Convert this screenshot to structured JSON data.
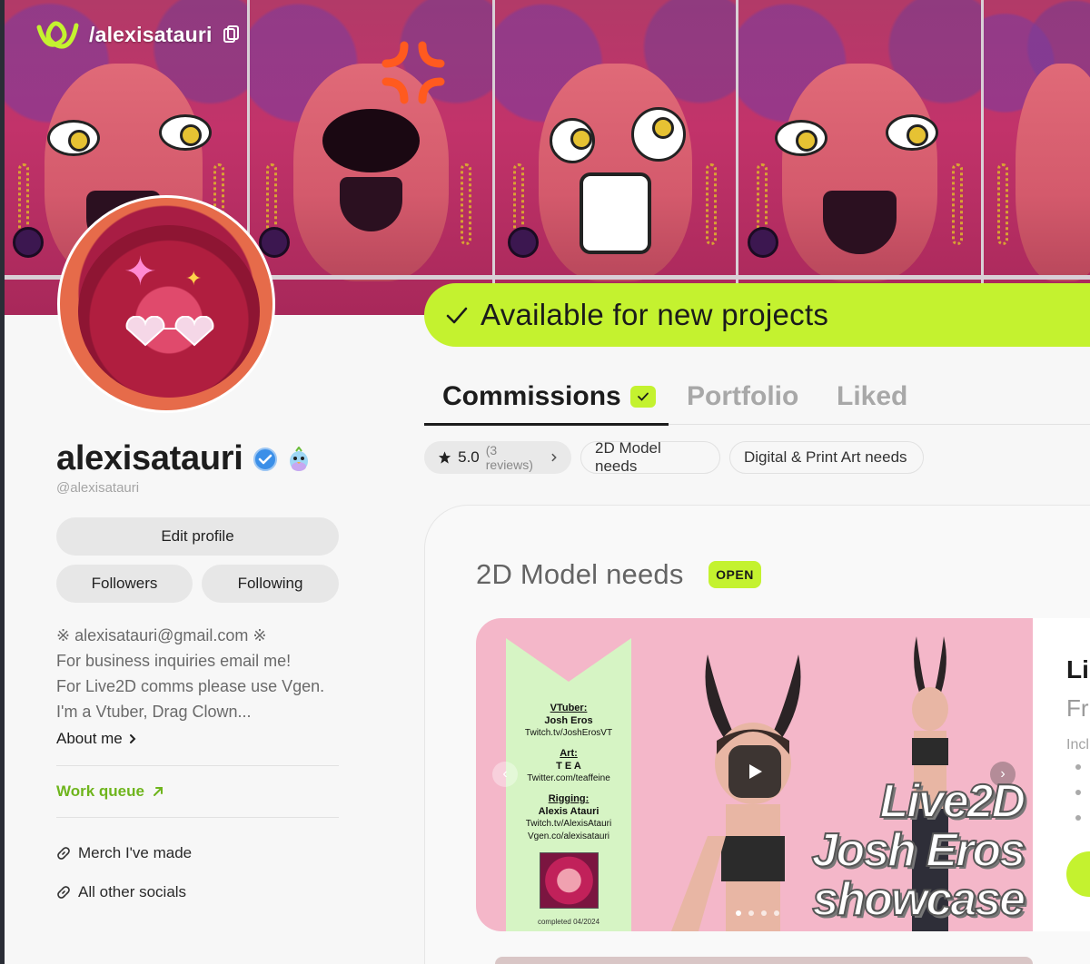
{
  "header": {
    "handle": "/alexisatauri"
  },
  "status": {
    "available": "Available for new projects"
  },
  "profile": {
    "display_name": "alexisatauri",
    "handle": "@alexisatauri",
    "edit_label": "Edit profile",
    "followers_label": "Followers",
    "following_label": "Following",
    "bio": [
      "※ alexisatauri@gmail.com ※",
      "For business inquiries email me!",
      "For Live2D comms please use Vgen.",
      "I'm a Vtuber, Drag Clown..."
    ],
    "about_label": "About me",
    "work_queue_label": "Work queue",
    "links": [
      "Merch I've made",
      "All other socials"
    ]
  },
  "tabs": [
    {
      "label": "Commissions",
      "active": true
    },
    {
      "label": "Portfolio",
      "active": false
    },
    {
      "label": "Liked",
      "active": false
    }
  ],
  "chips": {
    "rating": "5.0",
    "reviews": "(3 reviews)",
    "categories": [
      "2D Model needs",
      "Digital & Print Art needs"
    ]
  },
  "commission": {
    "title": "2D Model needs",
    "status_badge": "OPEN",
    "credits": {
      "vtuber_heading": "VTuber:",
      "vtuber_name": "Josh Eros",
      "vtuber_link": "Twitch.tv/JoshErosVT",
      "art_heading": "Art:",
      "art_name": "T E A",
      "art_link": "Twitter.com/teaffeine",
      "rigging_heading": "Rigging:",
      "rigging_name": "Alexis Atauri",
      "rigging_link1": "Twitch.tv/AlexisAtauri",
      "rigging_link2": "Vgen.co/alexisatauri",
      "completed": "completed 04/2024"
    },
    "showcase_lines": [
      "Live2D",
      "Josh Eros",
      "showcase"
    ],
    "info_title": "Li",
    "info_sub": "Fr",
    "info_included": "Incl"
  },
  "colors": {
    "accent": "#c4f22f",
    "work_queue": "#6fb51d",
    "verified": "#3b8fe8"
  },
  "icons": [
    "logo-icon",
    "copy-icon",
    "check-icon",
    "verified-icon",
    "bird-badge-icon",
    "chevron-right-icon",
    "arrow-up-right-icon",
    "link-icon",
    "star-icon",
    "play-icon"
  ]
}
